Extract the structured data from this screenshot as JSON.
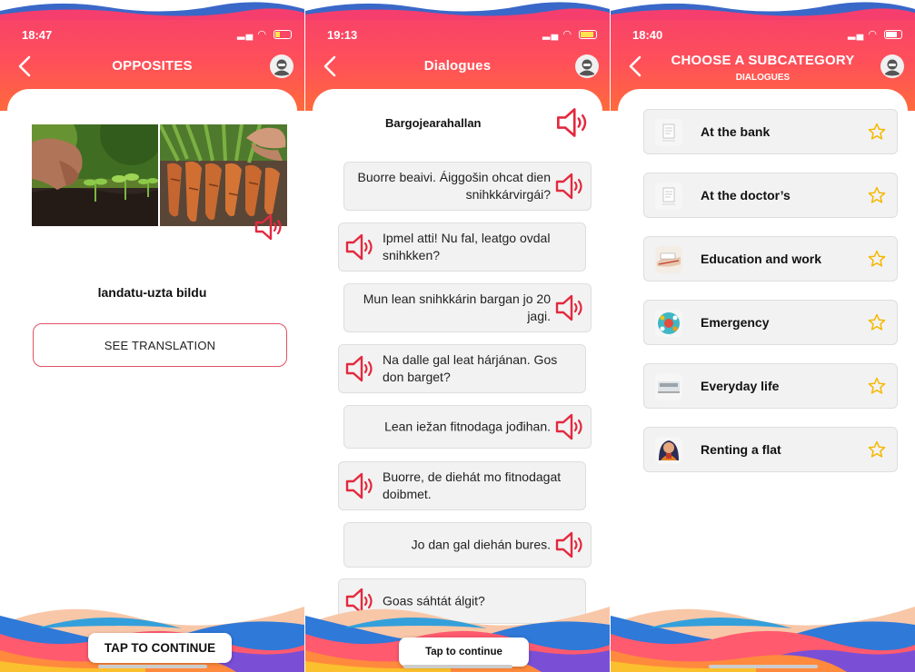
{
  "colors": {
    "header_top": "#f53e6e",
    "header_bottom": "#ff6a3c",
    "accent_red": "#e3293e",
    "bubble_bg": "#f2f2f2",
    "star": "#f5b800"
  },
  "screen1": {
    "time": "18:47",
    "title": "OPPOSITES",
    "word": "landatu-uzta bildu",
    "see_translation": "SEE TRANSLATION",
    "tap_continue": "TAP TO CONTINUE"
  },
  "screen2": {
    "time": "19:13",
    "title": "Dialogues",
    "heading": "Bargojearahallan",
    "lines": [
      {
        "side": "right",
        "text": "Buorre beaivi. Áiggošin ohcat dien snihkkárvirgái?"
      },
      {
        "side": "left",
        "text": "Ipmel atti! Nu fal, leatgo ovdal snihkken?"
      },
      {
        "side": "right",
        "text": "Mun lean snihkkárin bargan jo 20 jagi."
      },
      {
        "side": "left",
        "text": "Na dalle gal leat hárjánan. Gos don barget?"
      },
      {
        "side": "right",
        "text": "Lean iežan fitnodaga jođihan."
      },
      {
        "side": "left",
        "text": "Buorre, de diehát mo fitnodagat doibmet."
      },
      {
        "side": "right",
        "text": "Jo dan gal diehán bures."
      },
      {
        "side": "left",
        "text": "Goas sáhtát álgit?"
      }
    ],
    "tap_continue": "Tap to continue"
  },
  "screen3": {
    "time": "18:40",
    "title": "CHOOSE A SUBCATEGORY",
    "subtitle": "DIALOGUES",
    "items": [
      {
        "label": "At the bank",
        "icon": "bank-document-icon"
      },
      {
        "label": "At the doctor’s",
        "icon": "doctor-document-icon"
      },
      {
        "label": "Education and work",
        "icon": "education-work-icon"
      },
      {
        "label": "Emergency",
        "icon": "emergency-icon"
      },
      {
        "label": "Everyday life",
        "icon": "everyday-life-icon"
      },
      {
        "label": "Renting a flat",
        "icon": "renting-flat-icon"
      }
    ]
  }
}
